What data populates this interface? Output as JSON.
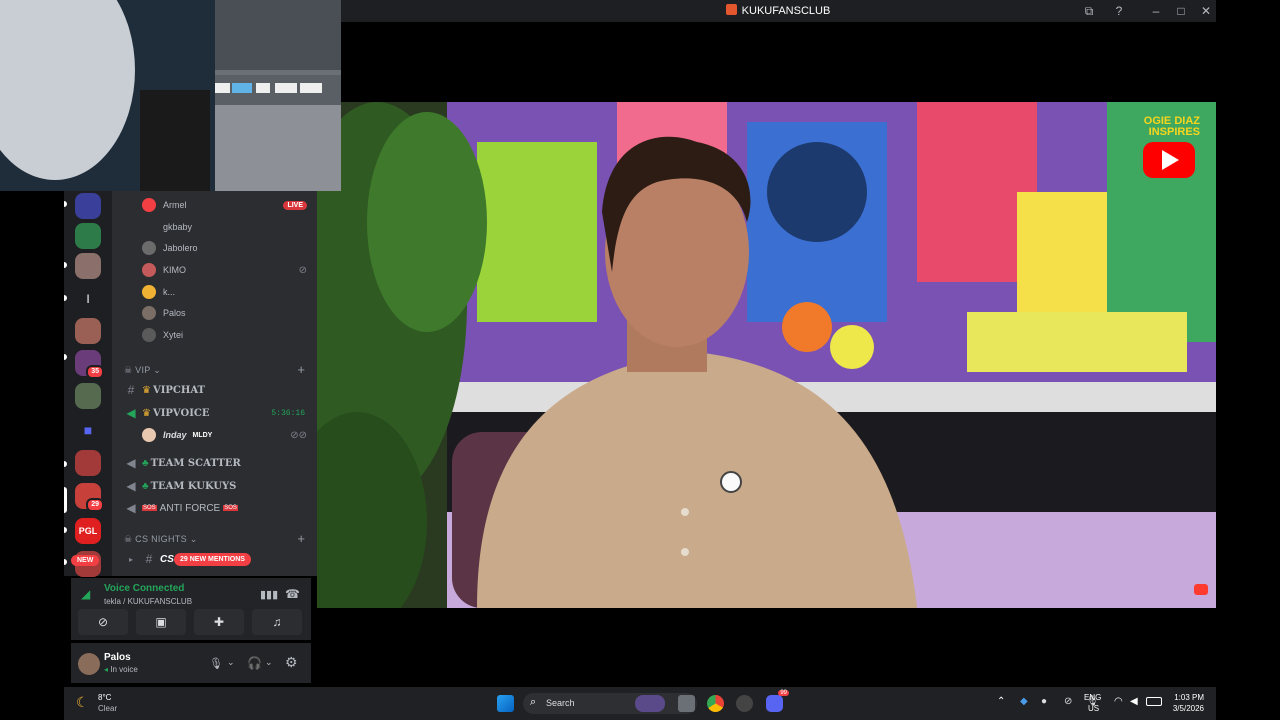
{
  "window": {
    "title": "KUKUFANSCLUB"
  },
  "stream": {
    "brand_line1": "OGIE DIAZ",
    "brand_line2": "INSPIRES"
  },
  "voice_users": [
    {
      "name": "Armel",
      "live": "LIVE"
    },
    {
      "name": "gkbaby"
    },
    {
      "name": "Jabolero"
    },
    {
      "name": "KIMO"
    },
    {
      "name": "k..."
    },
    {
      "name": "Palos"
    },
    {
      "name": "Xytei"
    }
  ],
  "categories": {
    "vip": "VIP",
    "cs_nights": "CS NIGHTS"
  },
  "channels": {
    "vipchat": "VIPCHAT",
    "vipvoice": "VIPVOICE",
    "vipvoice_timer": "5:36:16",
    "inday": "Inday",
    "inday_tag": "MLDY",
    "team_scatter": "TEAM SCATTER",
    "team_kukuys": "TEAM KUKUYS",
    "anti_force": "ANTI FORCE",
    "cs_nights_chan": "CS-NIG"
  },
  "mentions_pill": "29 NEW MENTIONS",
  "new_pill": "NEW",
  "guild_badges": {
    "b1": "35",
    "b2": "29"
  },
  "voice_panel": {
    "status": "Voice Connected",
    "location": "tekla / KUKUFANSCLUB"
  },
  "user_panel": {
    "name": "Palos",
    "status": "In voice"
  },
  "taskbar": {
    "weather_temp": "8°C",
    "weather_desc": "Clear",
    "search_placeholder": "Search",
    "lang1": "ENG",
    "lang2": "US",
    "time": "1:03 PM",
    "date": "3/5/2026",
    "discord_badge": "99"
  },
  "colors": {
    "accent_green": "#23a55a",
    "live_red": "#da373c",
    "blurple": "#5865f2"
  }
}
